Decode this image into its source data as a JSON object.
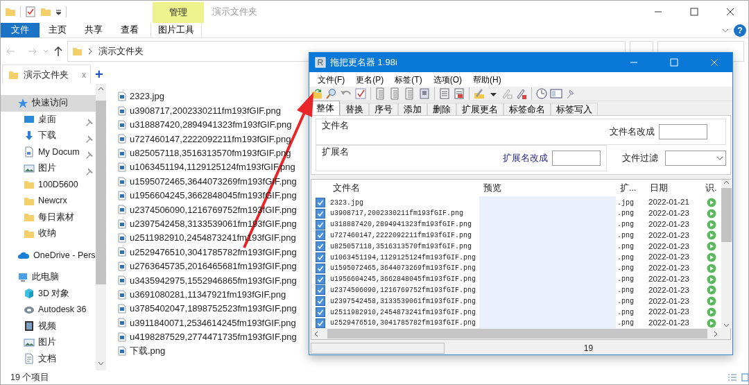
{
  "explorer": {
    "quick_access_bar": {
      "context_group": "管理",
      "title": "演示文件夹"
    },
    "ribbon_tabs": [
      {
        "label": "文件",
        "kind": "file"
      },
      {
        "label": "主页",
        "kind": "tab"
      },
      {
        "label": "共享",
        "kind": "tab"
      },
      {
        "label": "查看",
        "kind": "tab"
      },
      {
        "label": "图片工具",
        "kind": "context"
      }
    ],
    "help": "?",
    "address": {
      "path": "演示文件夹"
    },
    "folder_tab": {
      "label": "演示文件夹",
      "close": "x",
      "add": "+"
    },
    "sidebar": [
      {
        "label": "快速访问",
        "kind": "star",
        "selected": true,
        "pinned": false,
        "children": [
          {
            "label": "桌面",
            "kind": "desktop",
            "selected": false,
            "pinned": true
          },
          {
            "label": "下载",
            "kind": "download",
            "selected": false,
            "pinned": true
          },
          {
            "label": "My Docum",
            "kind": "document",
            "selected": false,
            "pinned": true
          },
          {
            "label": "图片",
            "kind": "picture",
            "selected": false,
            "pinned": true
          },
          {
            "label": "100D5600",
            "kind": "folder",
            "selected": false,
            "pinned": false
          },
          {
            "label": "Newcrx",
            "kind": "folder",
            "selected": false,
            "pinned": false
          },
          {
            "label": "每日素材",
            "kind": "folder",
            "selected": false,
            "pinned": false
          },
          {
            "label": "收纳",
            "kind": "folder",
            "selected": false,
            "pinned": false
          }
        ]
      },
      {
        "label": "OneDrive - Pers",
        "kind": "cloud",
        "selected": false,
        "pinned": false
      },
      {
        "label": "此电脑",
        "kind": "pc",
        "selected": false,
        "pinned": false,
        "children": [
          {
            "label": "3D 对象",
            "kind": "cube",
            "selected": false,
            "pinned": false
          },
          {
            "label": "Autodesk 36",
            "kind": "autodesk",
            "selected": false,
            "pinned": false
          },
          {
            "label": "视频",
            "kind": "video",
            "selected": false,
            "pinned": false
          },
          {
            "label": "图片",
            "kind": "picture",
            "selected": false,
            "pinned": false
          },
          {
            "label": "文档",
            "kind": "doc",
            "selected": false,
            "pinned": false
          }
        ]
      }
    ],
    "files": [
      "2323.jpg",
      "u3908717,2002330211fm193fGIF.png",
      "u318887420,2894941323fm193fGIF.png",
      "u727460147,2222092211fm193fGIF.png",
      "u825057118,3516313570fm193fGIF.png",
      "u1063451194,1129125124fm193fGIF.png",
      "u1595072465,3644073269fm193fGIF.png",
      "u1956604245,3662848045fm193fGIF.png",
      "u2374506090,1216769752fm193fGIF.png",
      "u2397542458,3133539061fm193fGIF.png",
      "u2511982910,2454873241fm193fGIF.png",
      "u2529476510,3041785782fm193fGIF.png",
      "u2763645735,2016465681fm193fGIF.png",
      "u3435942975,1552946865fm193fGIF.png",
      "u3691080281,11347921fm193fGIF.png",
      "u3785402047,1898752523fm193fGIF.png",
      "u3911840071,2534614245fm193fGIF.png",
      "u4198287529,2774471735fm193fGIF.png",
      "下载.png"
    ],
    "status_bar": "19 个项目"
  },
  "dialog": {
    "title": "拖把更名器 1.98i",
    "menu": [
      "文件(F)",
      "更名(P)",
      "标签(T)",
      "选项(O)",
      "帮助(H)"
    ],
    "tabs": [
      {
        "label": "整体",
        "selected": true
      },
      {
        "label": "替换",
        "selected": false
      },
      {
        "label": "序号",
        "selected": false
      },
      {
        "label": "添加",
        "selected": false
      },
      {
        "label": "删除",
        "selected": false
      },
      {
        "label": "扩展更名",
        "selected": false
      },
      {
        "label": "标签命名",
        "selected": false
      },
      {
        "label": "标签写入",
        "selected": false
      }
    ],
    "filename_group": {
      "title": "文件名",
      "field_label": "文件名改成"
    },
    "extension_group": {
      "title": "扩展名",
      "field_label": "扩展名改成"
    },
    "filter_label": "文件过滤",
    "table": {
      "columns": [
        "文件名",
        "预览",
        "扩...",
        "日期",
        "识."
      ],
      "rows": [
        {
          "checked": true,
          "name": "2323.jpg",
          "ext": ".jpg",
          "date": "2022-01-21"
        },
        {
          "checked": true,
          "name": "u3908717,2002330211fm193fGIF.png",
          "ext": ".png",
          "date": "2022-01-23"
        },
        {
          "checked": true,
          "name": "u318887420,2894941323fm193fGIF.png",
          "ext": ".png",
          "date": "2022-01-23"
        },
        {
          "checked": true,
          "name": "u727460147,2222092211fm193fGIF.png",
          "ext": ".png",
          "date": "2022-01-23"
        },
        {
          "checked": true,
          "name": "u825057118,3516313570fm193fGIF.png",
          "ext": ".png",
          "date": "2022-01-23"
        },
        {
          "checked": true,
          "name": "u1063451194,1129125124fm193fGIF.png",
          "ext": ".png",
          "date": "2022-01-23"
        },
        {
          "checked": true,
          "name": "u1595072465,3644073269fm193fGIF.png",
          "ext": ".png",
          "date": "2022-01-23"
        },
        {
          "checked": true,
          "name": "u1956604245,3662848045fm193fGIF.png",
          "ext": ".png",
          "date": "2022-01-23"
        },
        {
          "checked": true,
          "name": "u2374506090,1216769752fm193fGIF.png",
          "ext": ".png",
          "date": "2022-01-23"
        },
        {
          "checked": true,
          "name": "u2397542458,3133539061fm193fGIF.png",
          "ext": ".png",
          "date": "2022-01-23"
        },
        {
          "checked": true,
          "name": "u2511982910,2454873241fm193fGIF.png",
          "ext": ".png",
          "date": "2022-01-23"
        },
        {
          "checked": true,
          "name": "u2529476510,3041785782fm193fGIF.png",
          "ext": ".png",
          "date": "2022-01-23"
        }
      ]
    },
    "status": "19"
  }
}
